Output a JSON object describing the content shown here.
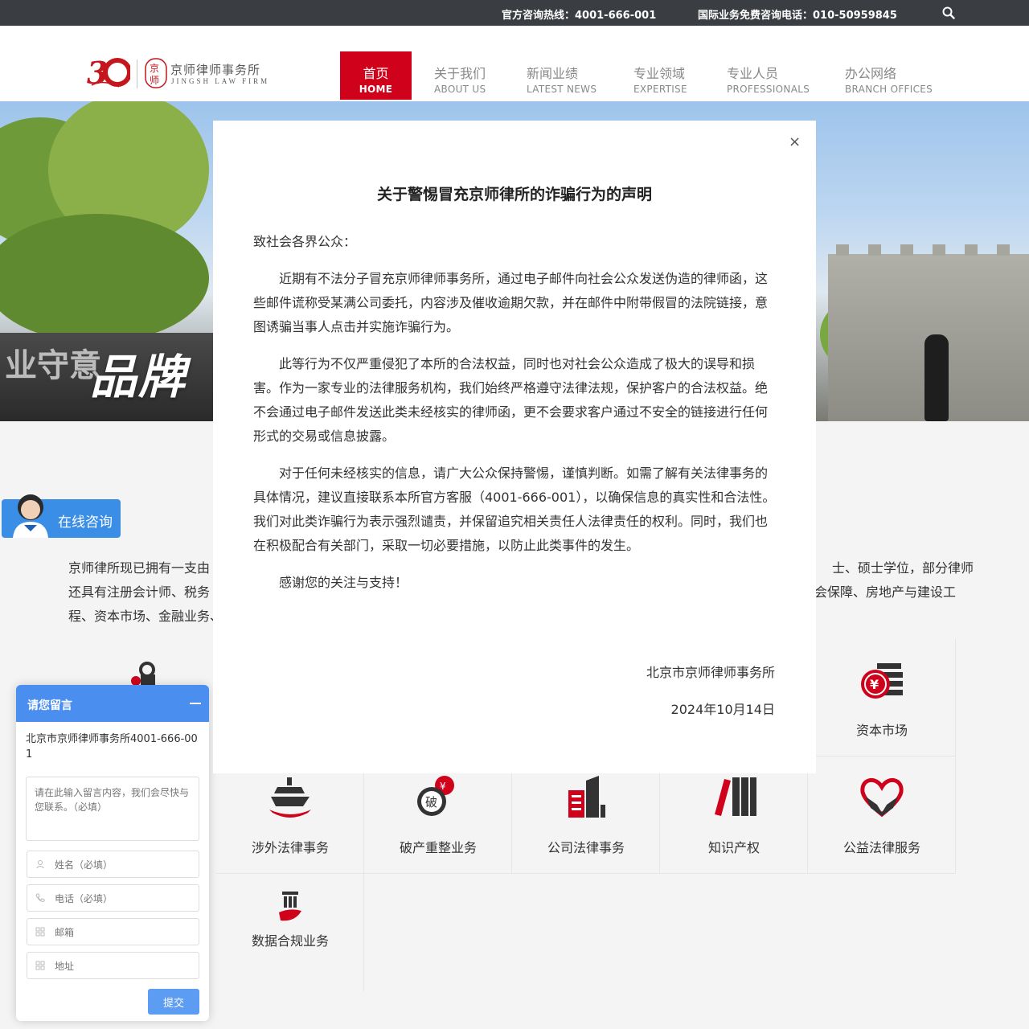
{
  "topbar": {
    "hotline": "官方咨询热线：4001-666-001",
    "intl_hotline": "国际业务免费咨询电话：010-50959845"
  },
  "logo": {
    "name_cn": "京师律师事务所",
    "name_en": "JINGSH LAW FIRM",
    "seal_text": "京师"
  },
  "nav": [
    {
      "cn": "首页",
      "en": "HOME",
      "active": true
    },
    {
      "cn": "关于我们",
      "en": "ABOUT US"
    },
    {
      "cn": "新闻业绩",
      "en": "LATEST NEWS"
    },
    {
      "cn": "专业领域",
      "en": "EXPERTISE"
    },
    {
      "cn": "专业人员",
      "en": "PROFESSIONALS"
    },
    {
      "cn": "办公网络",
      "en": "BRANCH OFFICES"
    }
  ],
  "hero": {
    "text": "品牌",
    "sign": "业守意"
  },
  "intro": {
    "line1": "京师律所现已拥有一支由",
    "line1_end": "士、硕士学位，部分律师",
    "line2": "还具有注册会计师、税务",
    "line2_end": "会保障、房地产与建设工",
    "line3": "程、资本市场、金融业务、"
  },
  "practice_areas": [
    {
      "label": "资本市场",
      "icon": "yen-coin-icon"
    },
    {
      "label": "涉外法律事务",
      "icon": "ship-icon"
    },
    {
      "label": "破产重整业务",
      "icon": "bankruptcy-coin-icon"
    },
    {
      "label": "公司法律事务",
      "icon": "building-icon"
    },
    {
      "label": "知识产权",
      "icon": "books-icon"
    },
    {
      "label": "公益法律服务",
      "icon": "heart-hands-icon"
    },
    {
      "label": "数据合规业务",
      "icon": "pillar-icon"
    }
  ],
  "coin_text": "破",
  "consult": {
    "label": "在线咨询"
  },
  "message_widget": {
    "title": "请您留言",
    "company": "北京市京师律师事务所4001-666-001",
    "content_placeholder": "请在此输入留言内容，我们会尽快与您联系。（必填）",
    "name_placeholder": "姓名（必填）",
    "phone_placeholder": "电话（必填）",
    "email_placeholder": "邮箱",
    "address_placeholder": "地址",
    "submit_label": "提交"
  },
  "modal": {
    "close_label": "×",
    "title": "关于警惕冒充京师律所的诈骗行为的声明",
    "salutation": "致社会各界公众：",
    "paragraphs": [
      "近期有不法分子冒充京师律师事务所，通过电子邮件向社会公众发送伪造的律师函，这些邮件谎称受某满公司委托，内容涉及催收逾期欠款，并在邮件中附带假冒的法院链接，意图诱骗当事人点击并实施诈骗行为。",
      "此等行为不仅严重侵犯了本所的合法权益，同时也对社会公众造成了极大的误导和损害。作为一家专业的法律服务机构，我们始终严格遵守法律法规，保护客户的合法权益。绝不会通过电子邮件发送此类未经核实的律师函，更不会要求客户通过不安全的链接进行任何形式的交易或信息披露。",
      "对于任何未经核实的信息，请广大公众保持警惕，谨慎判断。如需了解有关法律事务的具体情况，建议直接联系本所官方客服（4001-666-001），以确保信息的真实性和合法性。我们对此类诈骗行为表示强烈谴责，并保留追究相关责任人法律责任的权利。同时，我们也在积极配合有关部门，采取一切必要措施，以防止此类事件的发生。",
      "感谢您的关注与支持！"
    ],
    "signature": "北京市京师律师事务所",
    "date": "2024年10月14日"
  },
  "colors": {
    "brand_red": "#d0021b",
    "topbar": "#3a3d42",
    "widget_blue": "#4a8ef0"
  }
}
